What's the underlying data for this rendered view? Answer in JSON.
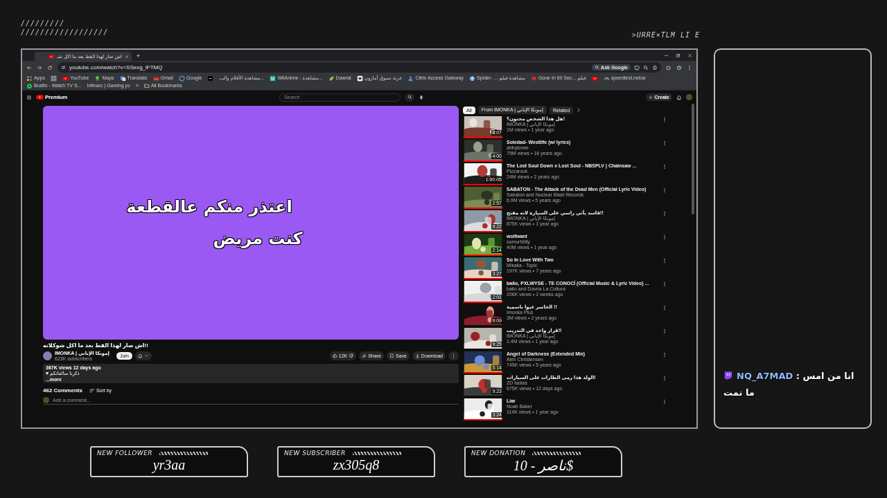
{
  "overlay_decor": {
    "slashes_short": "/////////",
    "slashes_long": "//////////////////",
    "code_text": ">URRE×TLM LI E"
  },
  "browser": {
    "tab": {
      "title": "اش صار لهذا القط بعد ما اكل شـ"
    },
    "address": {
      "url": "youtube.com/watch?v=SSexg_lFTMQ",
      "ask": "Ask Google"
    },
    "bookmarks": [
      {
        "kind": "apps",
        "label": "Apps"
      },
      {
        "kind": "grid"
      },
      {
        "kind": "yt",
        "label": "YouTube"
      },
      {
        "kind": "pin",
        "label": "Maps"
      },
      {
        "kind": "translate",
        "label": "Translate"
      },
      {
        "kind": "gmail",
        "label": "Gmail"
      },
      {
        "kind": "google",
        "label": "Google"
      },
      {
        "kind": "dark"
      },
      {
        "kind": "none",
        "label": "مشاهدة الأفلام والب..."
      },
      {
        "kind": "wit",
        "label": "WitAnime - مشاهدة..."
      },
      {
        "kind": "leaf",
        "label": "Dawrat"
      },
      {
        "kind": "cart",
        "label": "عربة تسوق أمازون"
      },
      {
        "kind": "citrix",
        "label": "Citrix Access Gateway"
      },
      {
        "kind": "spider",
        "label": "Spider- ... مشاهدة فيلم"
      },
      {
        "kind": "red",
        "label": "Gone In 60 Sec... فيلم"
      },
      {
        "kind": "yt"
      },
      {
        "kind": "gauge",
        "label": "speedtest.net/ar"
      },
      {
        "kind": "braflix",
        "label": "Braflix - Watch TV S..."
      },
      {
        "kind": "none",
        "label": "Infinarc | Gaming pc"
      }
    ],
    "bookmarks_more": "»",
    "all_bookmarks": "All Bookmarks",
    "youtube": {
      "logo": "Premium",
      "search_placeholder": "Search",
      "create": "Create",
      "video": {
        "lines": [
          "اعتذر منكم عالقطعة",
          "كنت مريض"
        ]
      },
      "title": "!!اش صار لهذا القط بعد ما اكل شوكلاته",
      "channel": {
        "name": "IMONKA | إمونكا الإباني",
        "subscribers": "623K subscribers",
        "join": "Join"
      },
      "actions": {
        "likes": "12K",
        "share": "Share",
        "save": "Save",
        "download": "Download"
      },
      "description": {
        "stats": "367K views  12 days ago",
        "line": "ذكرنا سالفاتكم ♥",
        "more": "...more"
      },
      "comments": {
        "count": "462 Comments",
        "sort": "Sort by",
        "placeholder": "Add a comment..."
      },
      "chips": [
        {
          "label": "All",
          "selected": true
        },
        {
          "label": "From IMONKA | إمونكا الإباني",
          "selected": false
        },
        {
          "label": "Related",
          "selected": false
        }
      ],
      "related": [
        {
          "title": "هل هذا الشخص مجنون؟!",
          "channel": "IMONKA | إمونكا الإباني",
          "meta": "1M views • 1 year ago",
          "duration": "8:07",
          "level": 1
        },
        {
          "title": "Soledad- Westlife (w/ lyrics)",
          "channel": "abbylovee",
          "meta": "75M views • 16 years ago",
          "duration": "4:00",
          "level": 1
        },
        {
          "title": "The Lost Soul Down x Lost Soul - NBSPLV | Chainsaw ...",
          "channel": "Pizzarock",
          "meta": "24M views • 2 years ago",
          "duration": "1:00:05",
          "level": 1
        },
        {
          "title": "SABATON - The Attack of the Dead Men (Official Lyric Video)",
          "channel": "Sabaton and Nuclear Blast Records",
          "meta": "6.9M views • 5 years ago",
          "duration": "2:57",
          "level": 1
        },
        {
          "title": "فاسد يأتي راسي على السيارة لانه مفتح!!",
          "channel": "IMONKA | إمونكا الإباني",
          "meta": "875K views • 1 year ago",
          "duration": "9:22",
          "level": 1
        },
        {
          "title": "wolfwant",
          "channel": "samurh0lly",
          "meta": "40M views • 1 year ago",
          "duration": "2:14",
          "level": 1
        },
        {
          "title": "So In Love With Two",
          "channel": "Mikaila - Topic",
          "meta": "197K views • 7 years ago",
          "duration": "3:27",
          "level": 1
        },
        {
          "title": "bailo, PXLWYSE - TE CONOCÍ (Official Music & Lyric Video) ...",
          "channel": "bailo and Dovna La Cultura",
          "meta": "206K views • 2 weeks ago",
          "duration": "2:01",
          "level": 1
        },
        {
          "title": "الخاسر عيوا باسمية !!",
          "channel": "Imonka Plus",
          "meta": "3M views • 2 years ago",
          "duration": "9:09"
        },
        {
          "title": "قرار واحد في التدريب!!",
          "channel": "IMONKA | إمونكا الإباني",
          "meta": "1.4M views • 1 year ago",
          "duration": "9:25"
        },
        {
          "title": "Angel of Darkness (Extended Mix)",
          "channel": "Alex Christensen",
          "meta": "745K views • 5 years ago",
          "duration": "5:14",
          "level": 1
        },
        {
          "title": "الولد هذا رمى الطارات على السيارات!",
          "channel": "ZD fadias",
          "meta": "675K views • 12 days ago",
          "duration": "9:23"
        },
        {
          "title": "Liar",
          "channel": "Noah Baker",
          "meta": "114K views • 1 year ago",
          "duration": "3:24",
          "level": 1
        }
      ]
    }
  },
  "chat": {
    "messages": [
      {
        "user": "NQ_A7MAD",
        "separator": ":",
        "text": "انا من امس ما نمت"
      }
    ]
  },
  "alerts": [
    {
      "label": "NEW FOLLOWER",
      "value": "yr3aa"
    },
    {
      "label": "NEW SUBSCRIBER",
      "value": "zx305q8"
    },
    {
      "label": "NEW DONATION",
      "value": "ناصر - 10$"
    }
  ]
}
